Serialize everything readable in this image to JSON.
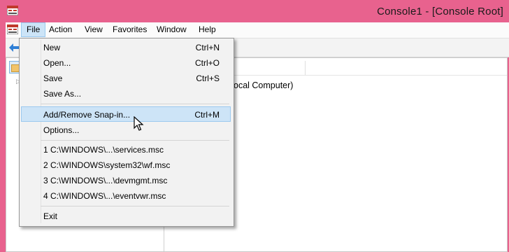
{
  "window": {
    "title": "Console1 - [Console Root]"
  },
  "menubar": {
    "items": [
      {
        "label": "File"
      },
      {
        "label": "Action"
      },
      {
        "label": "View"
      },
      {
        "label": "Favorites"
      },
      {
        "label": "Window"
      },
      {
        "label": "Help"
      }
    ]
  },
  "content": {
    "details_text": "ocal Computer)"
  },
  "file_menu": {
    "items": [
      {
        "label": "New",
        "shortcut": "Ctrl+N"
      },
      {
        "label": "Open...",
        "shortcut": "Ctrl+O"
      },
      {
        "label": "Save",
        "shortcut": "Ctrl+S"
      },
      {
        "label": "Save As...",
        "shortcut": ""
      },
      {
        "label": "Add/Remove Snap-in...",
        "shortcut": "Ctrl+M"
      },
      {
        "label": "Options...",
        "shortcut": ""
      },
      {
        "label": "1 C:\\WINDOWS\\...\\services.msc",
        "shortcut": ""
      },
      {
        "label": "2 C:\\WINDOWS\\system32\\wf.msc",
        "shortcut": ""
      },
      {
        "label": "3 C:\\WINDOWS\\...\\devmgmt.msc",
        "shortcut": ""
      },
      {
        "label": "4 C:\\WINDOWS\\...\\eventvwr.msc",
        "shortcut": ""
      },
      {
        "label": "Exit",
        "shortcut": ""
      }
    ],
    "highlighted_index": 4
  },
  "icons": [
    "app-icon",
    "back-arrow-icon",
    "folder-icon",
    "expand-arrow-icon",
    "mouse-cursor-icon"
  ],
  "colors": {
    "titlebar": "#e8628e",
    "highlight": "#cde4f7",
    "menu_bg": "#f2f2f2"
  }
}
